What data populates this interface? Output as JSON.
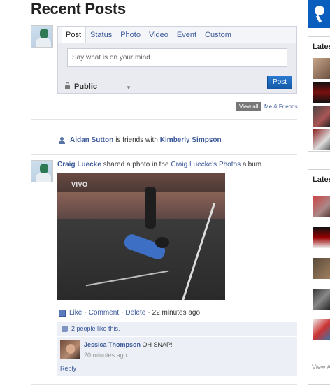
{
  "page": {
    "title": "Recent Posts"
  },
  "composer": {
    "tabs": [
      "Post",
      "Status",
      "Photo",
      "Video",
      "Event",
      "Custom"
    ],
    "placeholder": "Say what is on your mind...",
    "privacy": "Public",
    "submit_label": "Post"
  },
  "filters": {
    "view_all": "View all",
    "me_friends": "Me & Friends"
  },
  "activity": {
    "user_a": "Aidan Sutton",
    "verb": "is friends with",
    "user_b": "Kimberly Simpson"
  },
  "post": {
    "author": "Craig Luecke",
    "text_before": "shared a photo in the",
    "album_link": "Craig Luecke's Photos",
    "text_after": "album",
    "photo_watermark": "VIVO",
    "actions": {
      "like": "Like",
      "comment": "Comment",
      "delete": "Delete",
      "time": "22 minutes ago"
    },
    "likes": "2 people like this.",
    "comment": {
      "author": "Jessica Thompson",
      "text": "OH SNAP!",
      "time": "20 minutes ago"
    },
    "reply": "Reply"
  },
  "sidebar": {
    "heading_1": "Latest",
    "heading_2": "Latest",
    "view_all": "View All",
    "accent": "#0a5fbe"
  }
}
